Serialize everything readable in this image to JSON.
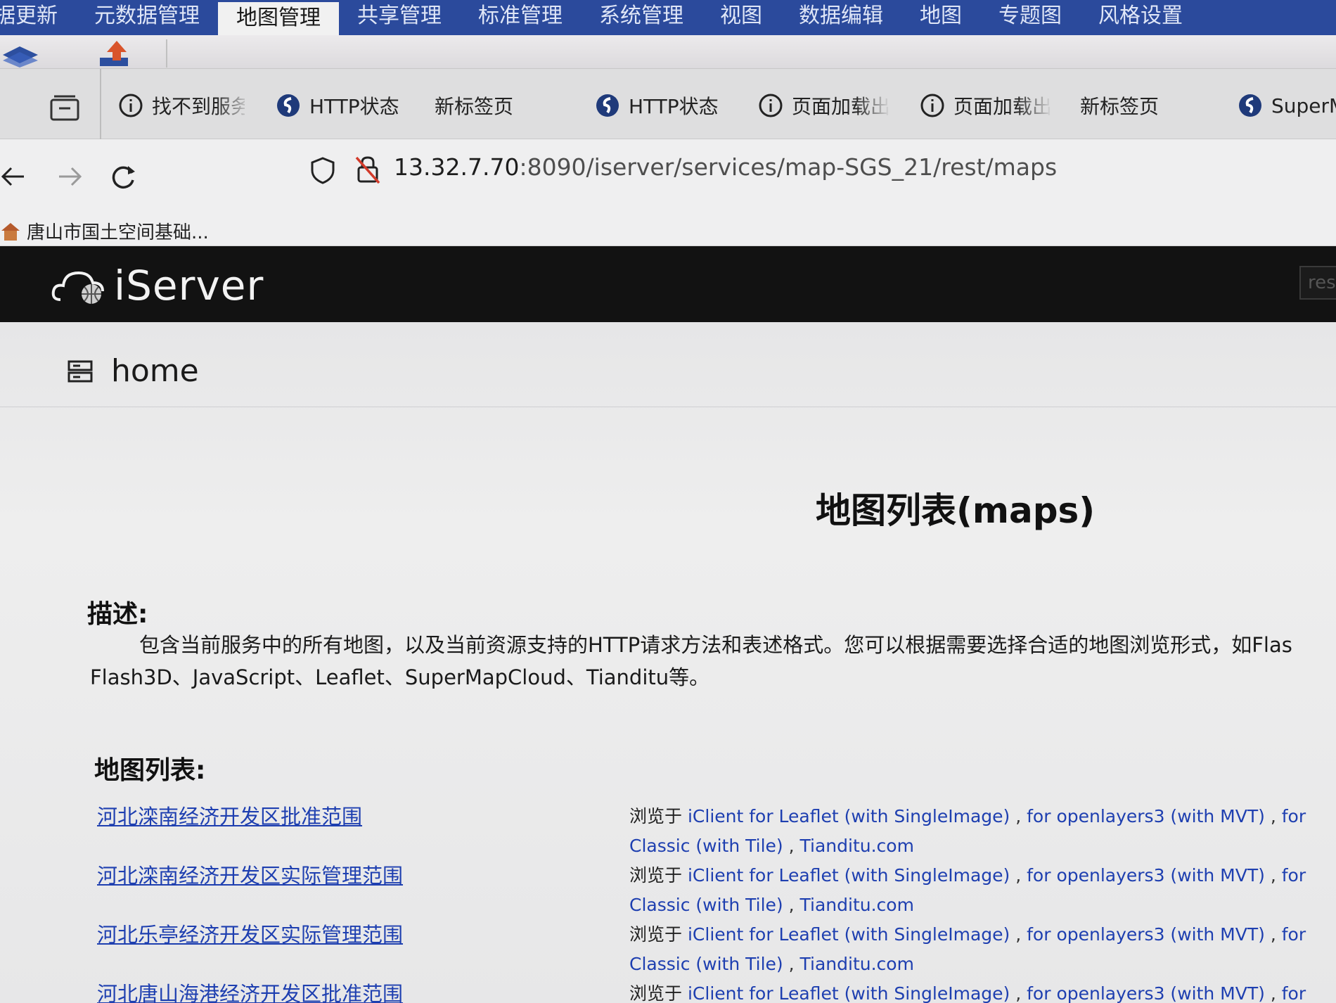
{
  "ribbon": {
    "tabs": [
      "据更新",
      "元数据管理",
      "地图管理",
      "共享管理",
      "标准管理",
      "系统管理",
      "视图",
      "数据编辑",
      "地图",
      "专题图",
      "风格设置"
    ],
    "active_tab": "地图管理"
  },
  "browser": {
    "tabs": [
      {
        "label": "找不到服务",
        "icon": "info-icon"
      },
      {
        "label": "HTTP状态",
        "icon": "supermap-icon"
      },
      {
        "label": "新标签页",
        "icon": ""
      },
      {
        "label": "HTTP状态",
        "icon": "supermap-icon"
      },
      {
        "label": "页面加载出",
        "icon": "info-icon"
      },
      {
        "label": "页面加载出",
        "icon": "info-icon"
      },
      {
        "label": "新标签页",
        "icon": ""
      },
      {
        "label": "SuperM",
        "icon": "supermap-icon"
      }
    ],
    "url_host": "13.32.7.70",
    "url_rest": ":8090/iserver/services/map-SGS_21/rest/maps",
    "bookmark": "唐山市国土空间基础..."
  },
  "iserver": {
    "brand": "iServer",
    "search_placeholder": "reso"
  },
  "page": {
    "home": "home",
    "title": "地图列表(maps)",
    "desc_heading": "描述:",
    "desc_line1": "包含当前服务中的所有地图，以及当前资源支持的HTTP请求方法和表述格式。您可以根据需要选择合适的地图浏览形式，如Flas",
    "desc_line2": "Flash3D、JavaScript、Leaflet、SuperMapCloud、Tianditu等。",
    "list_heading": "地图列表:",
    "browse_label": "浏览于",
    "browse_links": [
      "iClient for Leaflet (with SingleImage)",
      "for openlayers3 (with MVT)",
      "for Classic (with Tile)",
      "Tianditu.com"
    ],
    "maps": [
      "河北滦南经济开发区批准范围",
      "河北滦南经济开发区实际管理范围",
      "河北乐亭经济开发区实际管理范围",
      "河北唐山海港经济开发区批准范围"
    ]
  },
  "colors": {
    "ribbon_bg": "#2b4a9c",
    "header_bg": "#121212",
    "link": "#1e3fb0"
  }
}
